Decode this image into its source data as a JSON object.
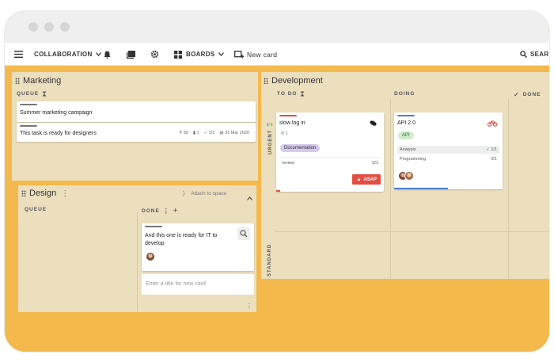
{
  "toolbar": {
    "workspace_label": "COLLABORATION",
    "boards_label": "BOARDS",
    "new_card_label": "New card",
    "search_label": "SEAR"
  },
  "marketing": {
    "title": "Marketing",
    "queue_label": "QUEUE",
    "card1_title": "Summer marketing campaign",
    "card2_title": "This task is ready for designers",
    "card2_points": "50",
    "card2_comments": "1",
    "card2_checks": "3/3",
    "card2_date": "31 Mar 2020"
  },
  "design": {
    "title": "Design",
    "attach_label": "Attach to space",
    "queue_label": "QUEUE",
    "done_label": "DONE",
    "card_title_line1": "And this one is ready for IT to",
    "card_title_line2": "develop",
    "new_card_placeholder": "Enter a title for new card"
  },
  "development": {
    "title": "Development",
    "todo_label": "TO DO",
    "doing_label": "DOING",
    "done_label": "DONE",
    "lane_urgent": "URGENT",
    "lane_standard": "STANDARD",
    "card1": {
      "title": "slow log in",
      "count": "1",
      "tag": "Documentation",
      "sub_label": "review",
      "sub_value": "0/1",
      "badge": "ASAP"
    },
    "card2": {
      "title": "API 2.0",
      "tag": "API",
      "sub1_label": "Analysis",
      "sub1_value": "1/1",
      "sub2_label": "Programming",
      "sub2_value": "0/1"
    }
  },
  "colors": {
    "board_bg": "#f4b94d",
    "panel_bg": "#ecdfbe",
    "accent_red": "#e44d42",
    "accent_blue": "#4a7fd0",
    "tag_purple": "#d8c9ef",
    "tag_green": "#cfeccc"
  }
}
